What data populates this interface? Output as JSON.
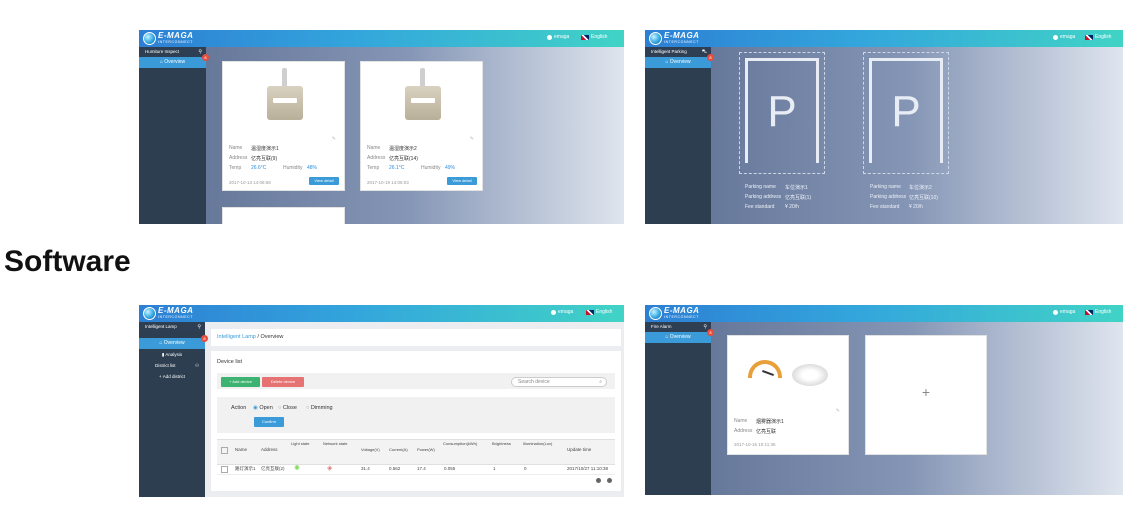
{
  "heading": "Software",
  "brand": {
    "name": "E-MAGA",
    "sub": "INTERCONNECT"
  },
  "user": "emaga",
  "language": "English",
  "panel1": {
    "module": "Humiture Inspect",
    "active": "Overview",
    "badge": "8",
    "cards": [
      {
        "name_label": "Name",
        "name": "温湿度演示1",
        "address_label": "Address",
        "address": "亿亮互联(9)",
        "temp_label": "Temp",
        "temp": "26.6°C",
        "humidity_label": "Humidity",
        "humidity": "48%",
        "time": "2017-10-13 14:06:58",
        "button": "View detail"
      },
      {
        "name_label": "Name",
        "name": "温湿度演示2",
        "address_label": "Address",
        "address": "亿亮互联(14)",
        "temp_label": "Temp",
        "temp": "26.1°C",
        "humidity_label": "Humidity",
        "humidity": "49%",
        "time": "2017-10-19 14:06:03",
        "button": "View detail"
      }
    ]
  },
  "panel2": {
    "module": "Intelligent Parking",
    "active": "Overview",
    "badge": "8",
    "slots": [
      {
        "letter": "P",
        "name_label": "Parking name",
        "name": "车位演示1",
        "addr_label": "Parking address",
        "addr": "亿亮互联(1)",
        "fee_label": "Fee standard",
        "fee": "¥ 20/h"
      },
      {
        "letter": "P",
        "name_label": "Parking name",
        "name": "车位演示2",
        "addr_label": "Parking address",
        "addr": "亿亮互联(10)",
        "fee_label": "Fee standard",
        "fee": "¥ 20/h"
      }
    ]
  },
  "panel3": {
    "module": "Intelligent Lamp",
    "active": "Overview",
    "badge": "8",
    "nav": [
      "Analysis",
      "District list",
      "Add district"
    ],
    "breadcrumb": [
      "Intelligent Lamp",
      "Overview"
    ],
    "device_list": "Device list",
    "add_button": "+ Add device",
    "delete_button": "Delete device",
    "search_placeholder": "Search device",
    "action_label": "Action",
    "options": [
      "Open",
      "Close",
      "Dimming"
    ],
    "confirm": "Confirm",
    "columns": [
      "Name",
      "Address",
      "Light state",
      "Network state",
      "Voltage(V)",
      "Current(A)",
      "Power(W)",
      "Consumption(kWh)",
      "Brightness",
      "Illumination(Lux)",
      "Update time"
    ],
    "row": {
      "name": "路灯演示1",
      "address": "亿亮互联(2)",
      "voltage": "31.4",
      "current": "0.562",
      "power": "17.4",
      "consumption": "0.055",
      "brightness": "1",
      "illumination": "0",
      "time": "2017/10/27 11:10:38"
    }
  },
  "panel4": {
    "module": "Fire Alarm",
    "active": "Overview",
    "badge": "8",
    "card": {
      "name_label": "Name",
      "name": "烟雾器演示1",
      "address_label": "Address",
      "address": "亿亮互联",
      "time": "2017-10-16 10:11:35"
    },
    "add_symbol": "+"
  }
}
